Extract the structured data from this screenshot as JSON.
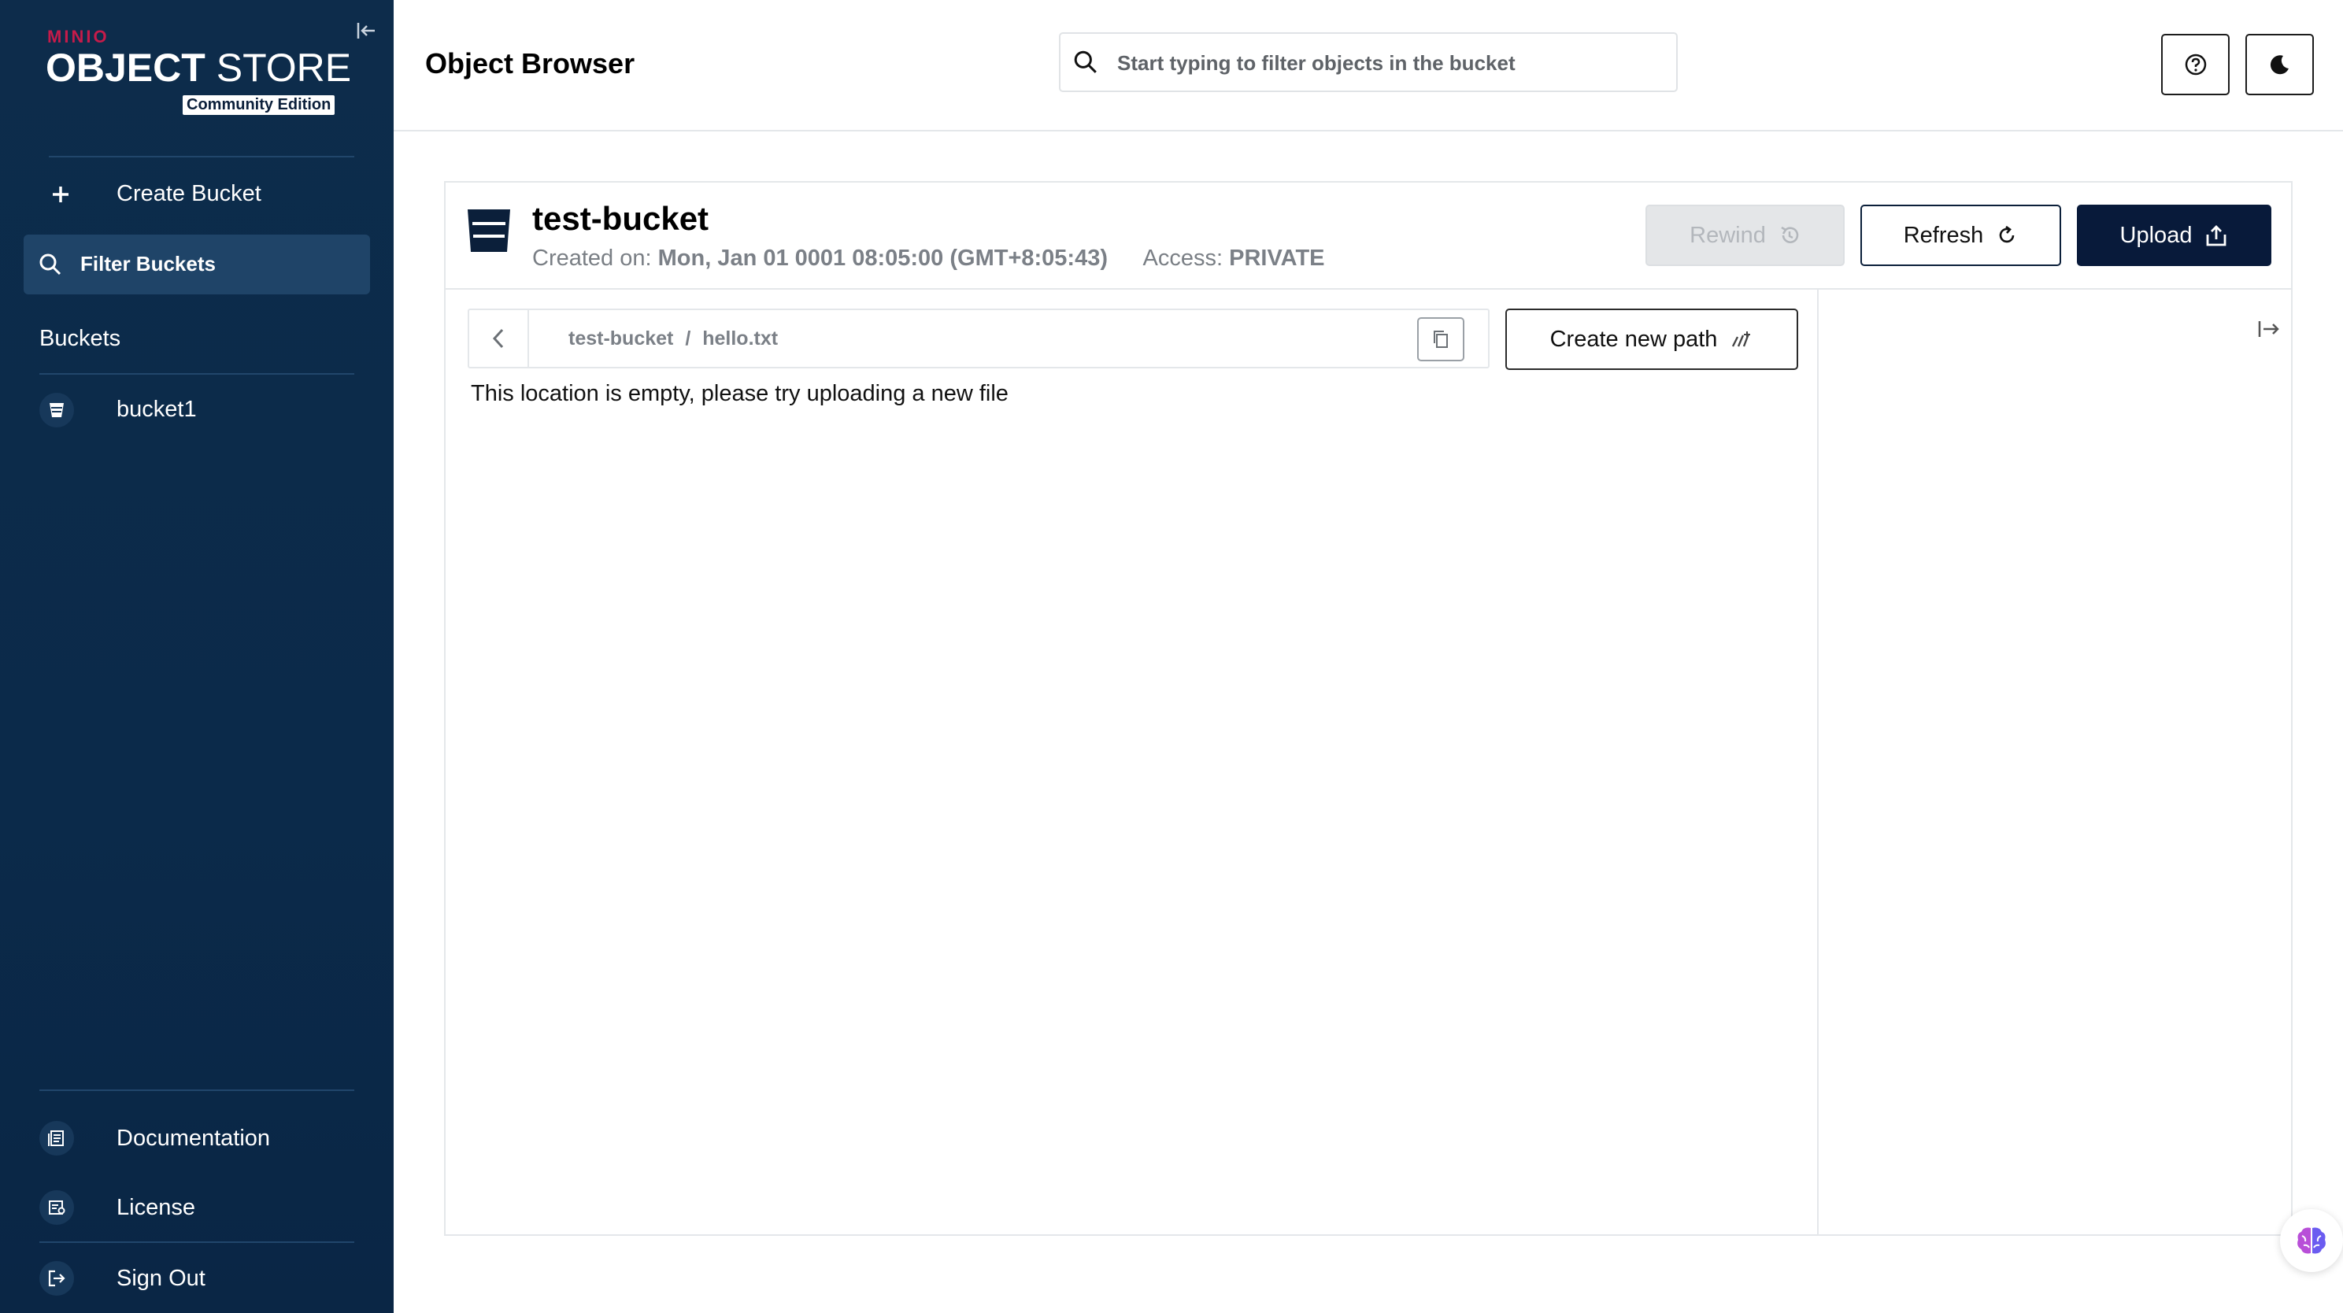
{
  "brand": {
    "minio": "MINIO",
    "object": "OBJECT",
    "store": "STORE",
    "edition": "Community Edition"
  },
  "sidebar": {
    "create_bucket": "Create Bucket",
    "filter_buckets": "Filter Buckets",
    "buckets_heading": "Buckets",
    "buckets": [
      {
        "label": "bucket1"
      }
    ],
    "footer": [
      {
        "label": "Documentation",
        "icon": "documentation-icon"
      },
      {
        "label": "License",
        "icon": "license-icon"
      },
      {
        "label": "Sign Out",
        "icon": "sign-out-icon"
      }
    ]
  },
  "header": {
    "title": "Object Browser",
    "search_placeholder": "Start typing to filter objects in the bucket"
  },
  "bucket": {
    "name": "test-bucket",
    "created_label": "Created on:",
    "created_value": "Mon, Jan 01 0001 08:05:00 (GMT+8:05:43)",
    "access_label": "Access:",
    "access_value": "PRIVATE",
    "rewind_label": "Rewind",
    "refresh_label": "Refresh",
    "upload_label": "Upload"
  },
  "path": {
    "segments": [
      "test-bucket",
      "hello.txt"
    ],
    "separator": "/",
    "create_new_path_label": "Create new path"
  },
  "empty_message": "This location is empty, please try uploading a new file",
  "colors": {
    "sidebar_bg": "#0b2a4a",
    "primary_dark": "#081a3a",
    "brand_red": "#c51b4a",
    "disabled_bg": "#e4e6e8"
  }
}
